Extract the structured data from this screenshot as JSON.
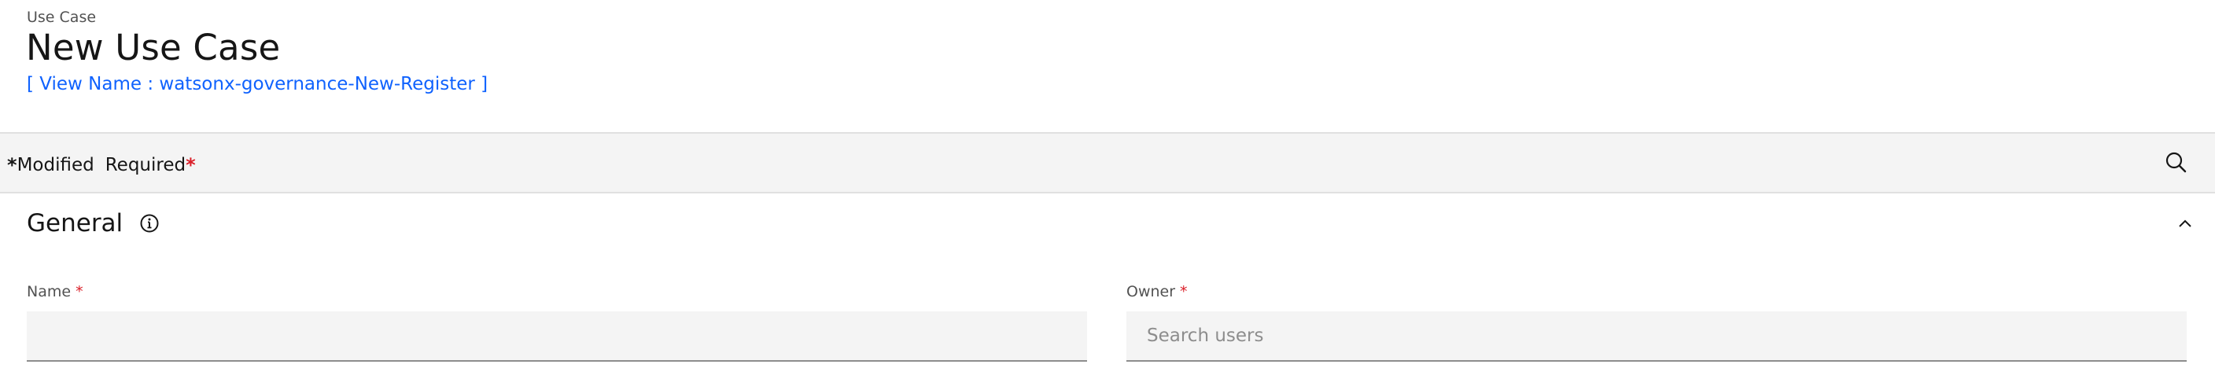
{
  "header": {
    "breadcrumb": "Use Case",
    "title": "New Use Case",
    "view_name": "[ View Name : watsonx-governance-New-Register ]"
  },
  "toolbar": {
    "modified_star": "*",
    "modified_label": "Modified",
    "required_label": "Required",
    "required_star": "*",
    "search_icon": "search-icon"
  },
  "section": {
    "title": "General",
    "info_icon": "info-icon",
    "collapse_icon": "chevron-up-icon",
    "fields": {
      "name": {
        "label": "Name",
        "required_mark": "*",
        "value": "",
        "placeholder": ""
      },
      "owner": {
        "label": "Owner",
        "required_mark": "*",
        "value": "",
        "placeholder": "Search users"
      }
    }
  },
  "colors": {
    "link": "#0f62fe",
    "required": "#da1e28",
    "toolbar_bg": "#f4f4f4",
    "field_bg": "#f4f4f4"
  }
}
